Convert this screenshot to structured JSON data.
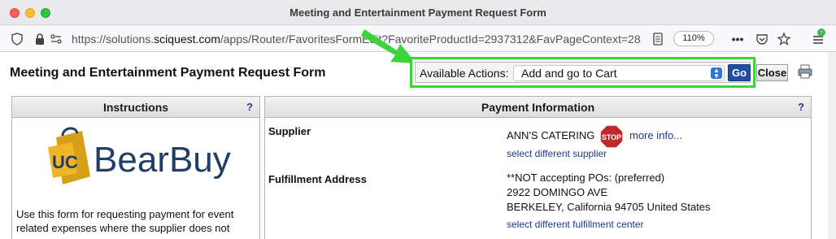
{
  "window": {
    "title": "Meeting and Entertainment Payment Request Form"
  },
  "browser": {
    "url_prefix": "https://solutions.",
    "url_host": "sciquest.com",
    "url_suffix": "/apps/Router/FavoritesFormEdit?FavoriteProductId=2937312&FavPageContext=28",
    "zoom": "110%"
  },
  "page": {
    "title": "Meeting and Entertainment Payment Request Form"
  },
  "actions": {
    "label": "Available Actions:",
    "selected": "Add and go to Cart",
    "go_label": "Go",
    "close_label": "Close"
  },
  "instructions": {
    "header": "Instructions",
    "help": "?",
    "logo_text": "BearBuy",
    "logo_badge": "UC",
    "body": "Use this form for requesting payment for event related expenses where the supplier does not"
  },
  "payment": {
    "header": "Payment Information",
    "help": "?",
    "supplier_label": "Supplier",
    "supplier_name": "ANN'S CATERING",
    "stop_text": "STOP",
    "more_info": "more info...",
    "select_supplier": "select different supplier",
    "fulfillment_label": "Fulfillment Address",
    "address_line1": "**NOT accepting POs: (preferred)",
    "address_line2": "2922 DOMINGO AVE",
    "address_line3": "BERKELEY, California 94705 United States",
    "select_fulfillment": "select different fulfillment center"
  },
  "colors": {
    "highlight": "#3bd43b",
    "go_button": "#1f4fa0",
    "link": "#1a3c8c",
    "stop": "#c0282e"
  }
}
